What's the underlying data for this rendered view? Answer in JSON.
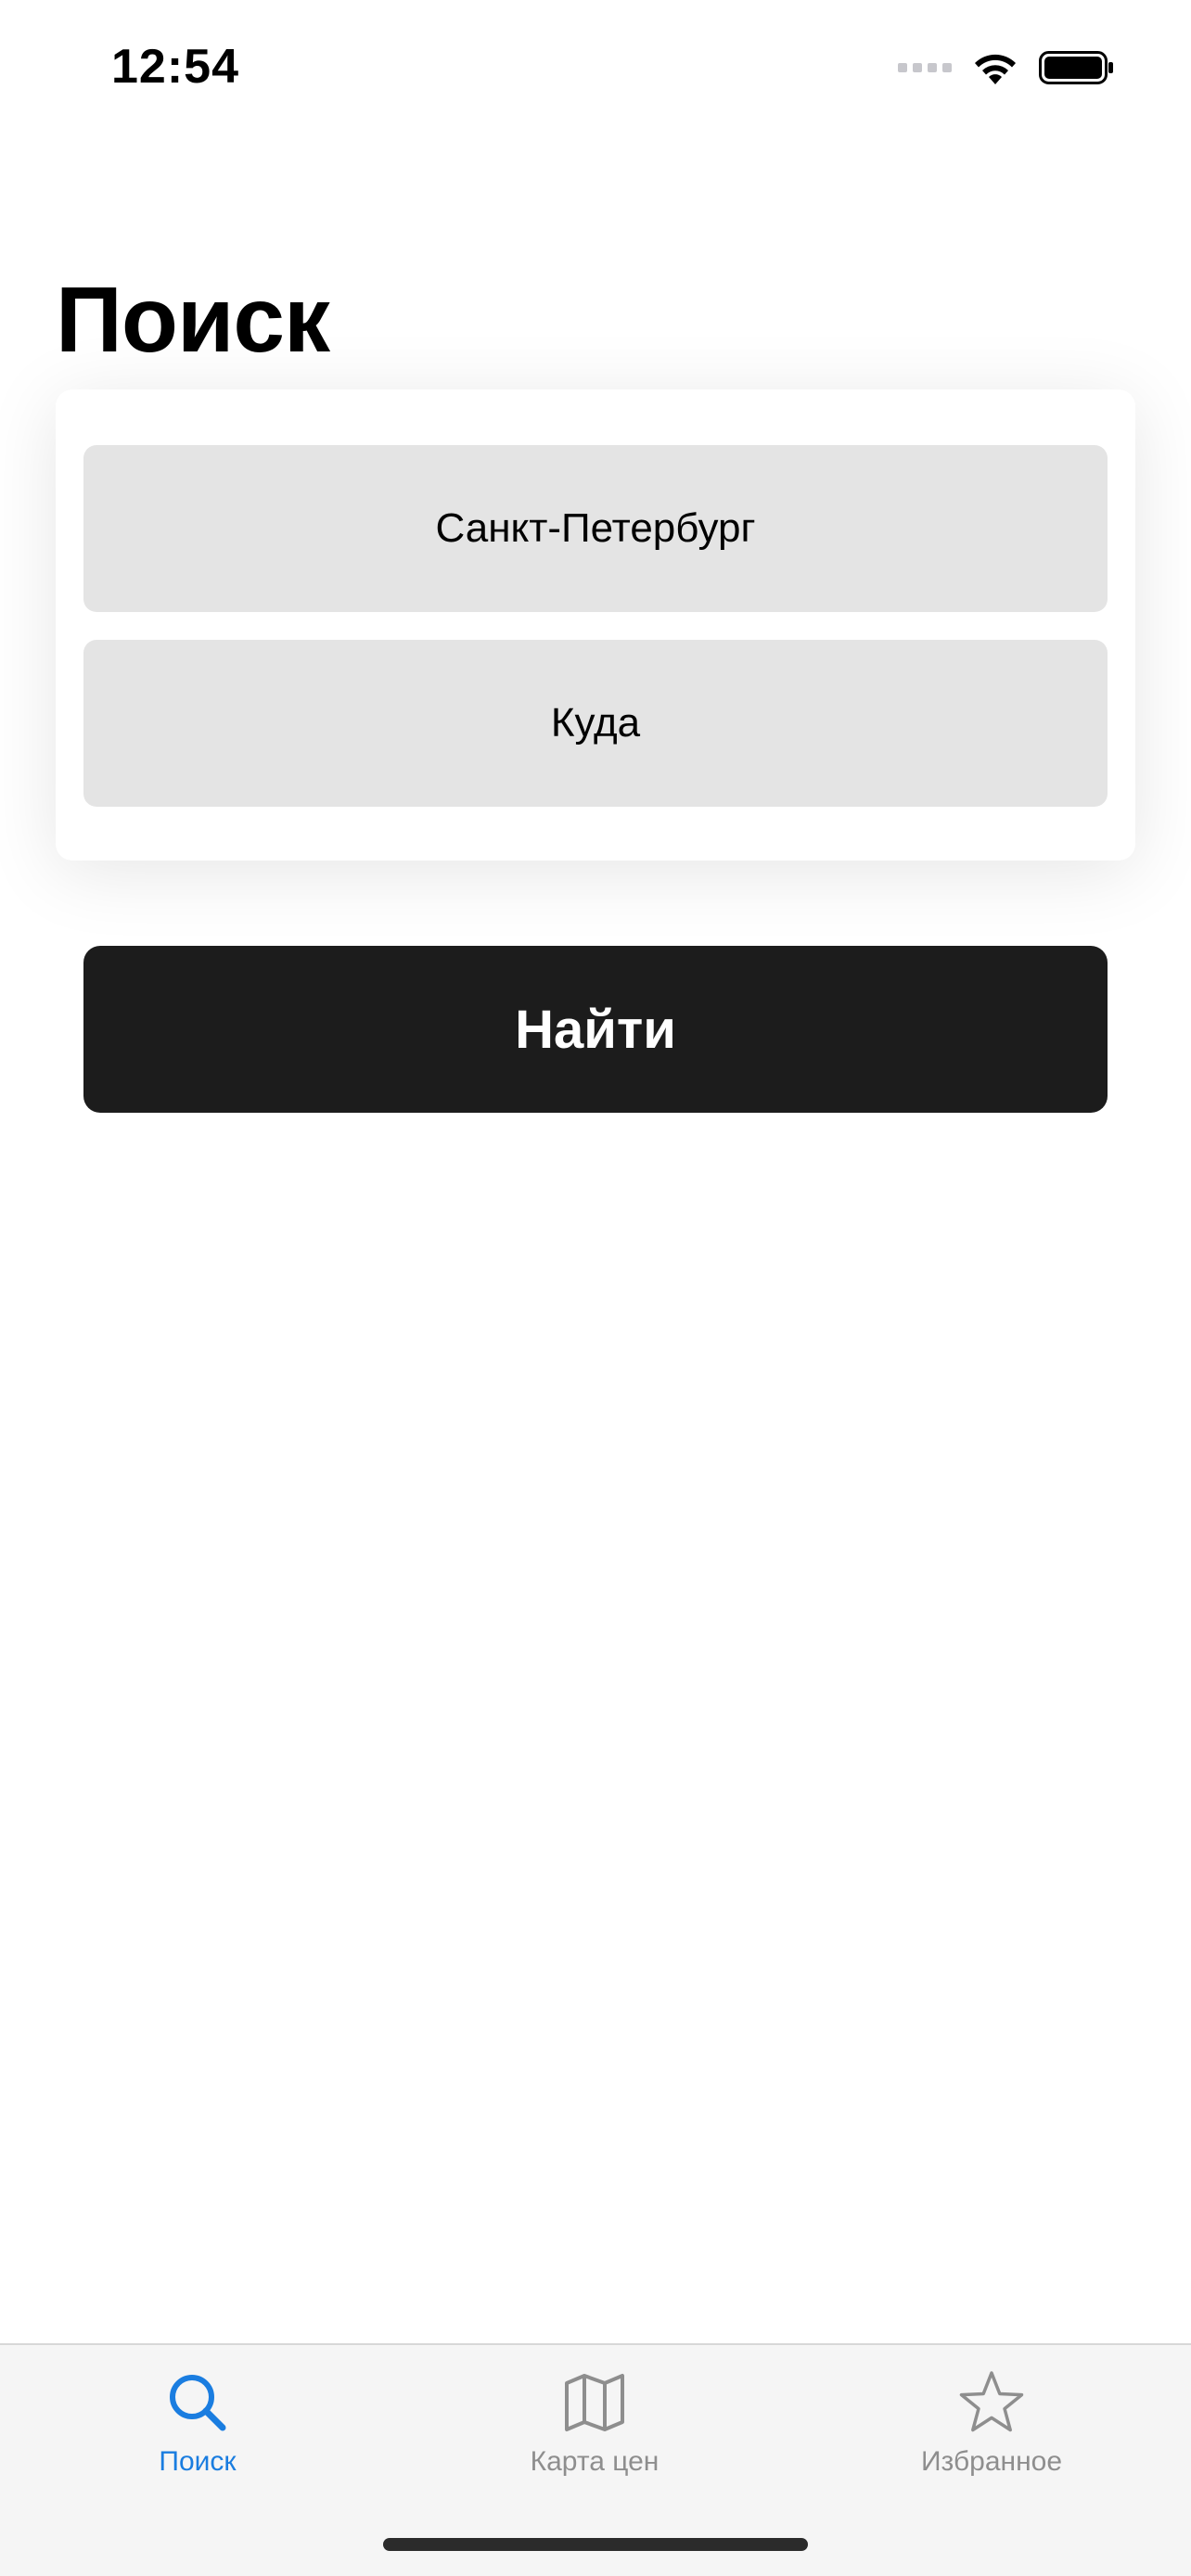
{
  "status_bar": {
    "time": "12:54"
  },
  "header": {
    "title": "Поиск"
  },
  "search_form": {
    "origin_value": "Санкт-Петербург",
    "destination_placeholder": "Куда",
    "find_button_label": "Найти"
  },
  "tab_bar": {
    "tabs": [
      {
        "label": "Поиск",
        "icon": "search-icon",
        "active": true
      },
      {
        "label": "Карта цен",
        "icon": "map-icon",
        "active": false
      },
      {
        "label": "Избранное",
        "icon": "star-icon",
        "active": false
      }
    ]
  },
  "colors": {
    "accent": "#1a7de0",
    "inactive": "#8e8e8e",
    "field_background": "#e4e4e4",
    "button_background": "#1c1c1c"
  }
}
